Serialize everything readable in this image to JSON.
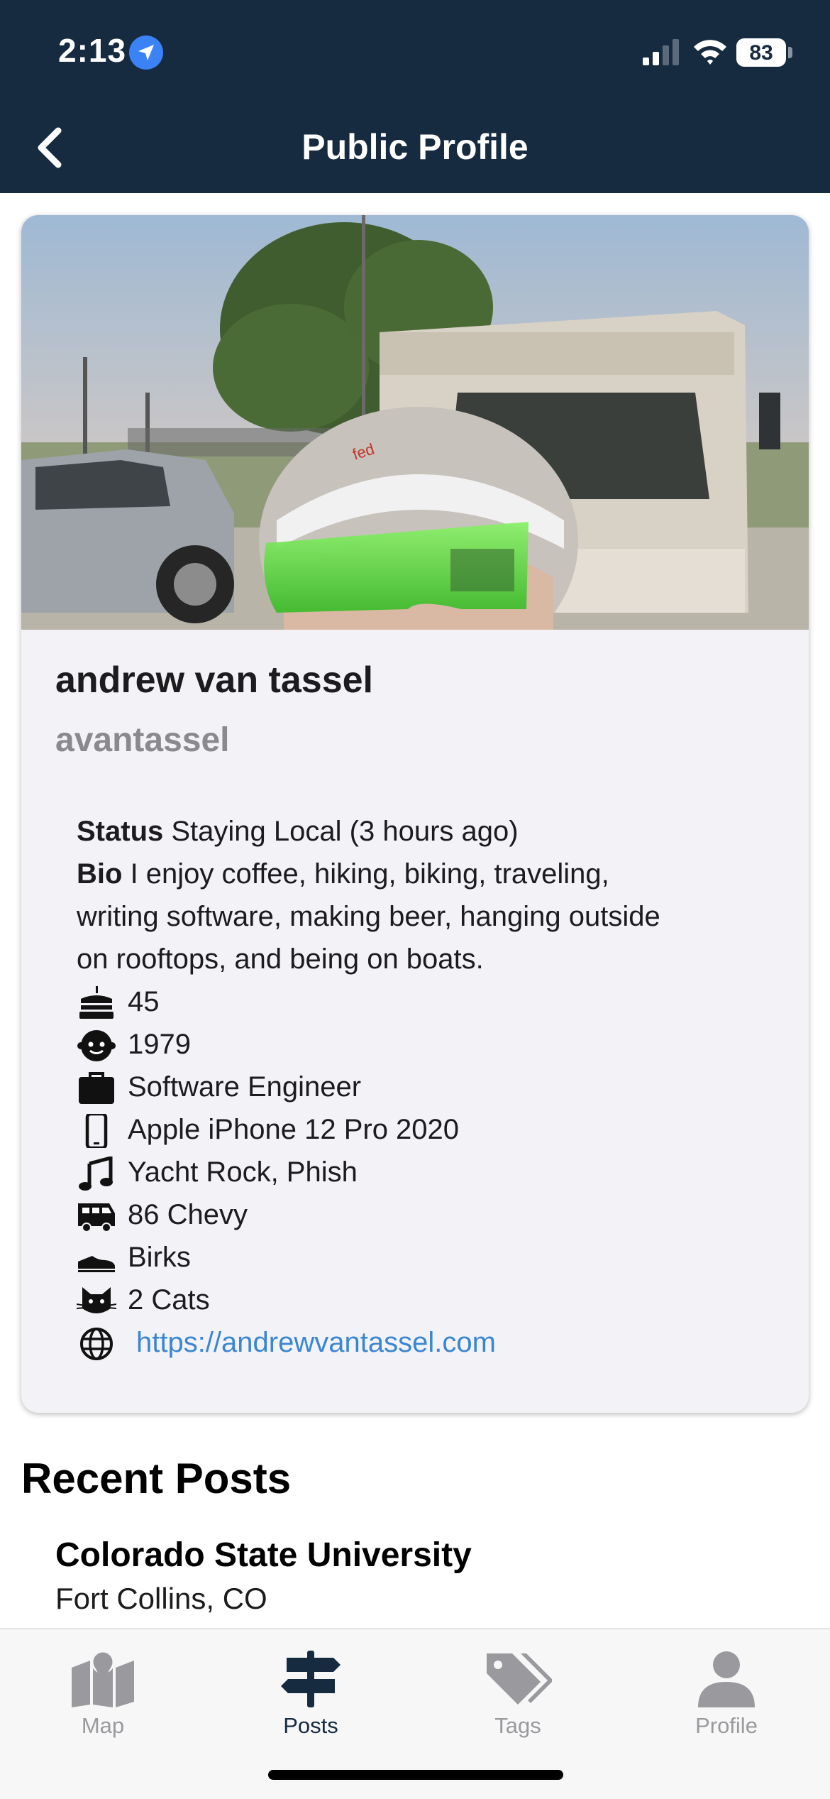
{
  "status_bar": {
    "time": "2:13",
    "battery": "83"
  },
  "nav": {
    "title": "Public Profile",
    "back_icon": "chevron-left-icon"
  },
  "profile": {
    "display_name": "andrew van tassel",
    "username": "avantassel",
    "status_label": "Status",
    "status_value": "Staying Local (3 hours ago)",
    "bio_label": "Bio",
    "bio_lines": [
      "I enjoy coffee, hiking, biking, traveling,",
      "writing software, making beer, hanging outside",
      "on rooftops, and being on boats."
    ],
    "attributes": [
      {
        "icon": "birthday-cake-icon",
        "text": "45"
      },
      {
        "icon": "child-face-icon",
        "text": "1979"
      },
      {
        "icon": "briefcase-icon",
        "text": "Software Engineer"
      },
      {
        "icon": "phone-icon",
        "text": "Apple iPhone 12 Pro 2020"
      },
      {
        "icon": "music-note-icon",
        "text": "Yacht Rock, Phish"
      },
      {
        "icon": "rv-icon",
        "text": "86 Chevy"
      },
      {
        "icon": "shoe-icon",
        "text": "Birks"
      },
      {
        "icon": "cat-icon",
        "text": "2 Cats"
      }
    ],
    "website": {
      "icon": "globe-icon",
      "url": "https://andrewvantassel.com"
    }
  },
  "recent_posts": {
    "title": "Recent Posts",
    "items": [
      {
        "title": "Colorado State University",
        "location": "Fort Collins, CO"
      }
    ]
  },
  "tabs": [
    {
      "label": "Map",
      "icon": "map-icon",
      "active": false
    },
    {
      "label": "Posts",
      "icon": "signpost-icon",
      "active": true
    },
    {
      "label": "Tags",
      "icon": "tags-icon",
      "active": false
    },
    {
      "label": "Profile",
      "icon": "person-icon",
      "active": false
    }
  ],
  "colors": {
    "header": "#172b40",
    "card_background": "#f2f2f7",
    "link": "#3a86d1",
    "tab_active": "#172b40",
    "tab_inactive": "#9a9a9e"
  }
}
